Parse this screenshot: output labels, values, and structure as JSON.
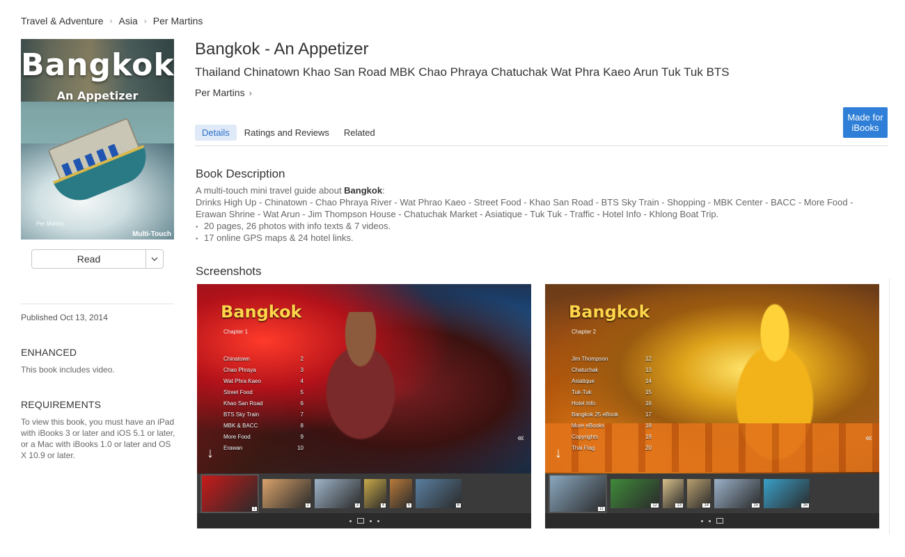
{
  "breadcrumb": [
    "Travel & Adventure",
    "Asia",
    "Per Martins"
  ],
  "cover": {
    "title": "Bangkok",
    "subtitle": "An Appetizer",
    "tag": "Multi-Touch",
    "signature": "Per Martins"
  },
  "read_button": {
    "label": "Read"
  },
  "published": "Published Oct 13, 2014",
  "enhanced": {
    "heading": "ENHANCED",
    "text": "This book includes video."
  },
  "requirements": {
    "heading": "REQUIREMENTS",
    "text": "To view this book, you must have an iPad with iBooks 3 or later and iOS 5.1 or later, or a Mac with iBooks 1.0 or later and OS X 10.9 or later."
  },
  "book": {
    "title": "Bangkok - An Appetizer",
    "subtitle": "Thailand Chinatown Khao San Road MBK Chao Phraya Chatuchak Wat Phra Kaeo Arun Tuk Tuk BTS",
    "author": "Per Martins"
  },
  "badge": {
    "line1": "Made for",
    "line2": "iBooks"
  },
  "tabs": [
    {
      "label": "Details",
      "active": true
    },
    {
      "label": "Ratings and Reviews",
      "active": false
    },
    {
      "label": "Related",
      "active": false
    }
  ],
  "description": {
    "heading": "Book Description",
    "intro_prefix": "A multi-touch mini travel guide about ",
    "intro_bold": "Bangkok",
    "intro_suffix": ":",
    "body": "Drinks High Up - Chinatown - Chao Phraya River - Wat Phrao Kaeo - Street Food - Khao San Road - BTS Sky Train - Shopping - MBK Center - BACC - More Food - Erawan Shrine - Wat Arun - Jim Thompson House - Chatuchak Market - Asiatique - Tuk Tuk - Traffic - Hotel Info - Khlong Boat Trip.",
    "bullets": [
      "20 pages, 26 photos with info texts & 7 videos.",
      "17 online GPS maps & 24 hotel links."
    ]
  },
  "screenshots": {
    "heading": "Screenshots",
    "items": [
      {
        "title": "Bangkok",
        "chapter": "Chapter 1",
        "toc": [
          [
            "Chinatown",
            "2"
          ],
          [
            "Chao Phraya",
            "3"
          ],
          [
            "Wat Phra Kaeo",
            "4"
          ],
          [
            "Street Food",
            "5"
          ],
          [
            "Khao San Road",
            "6"
          ],
          [
            "BTS Sky Train",
            "7"
          ],
          [
            "MBK & BACC",
            "8"
          ],
          [
            "More Food",
            "9"
          ],
          [
            "Erawan",
            "10"
          ]
        ],
        "thumbs": [
          "1",
          "2",
          "3",
          "4",
          "5",
          "6"
        ]
      },
      {
        "title": "Bangkok",
        "chapter": "Chapter 2",
        "toc": [
          [
            "Jim Thompson",
            "12"
          ],
          [
            "Chatuchak",
            "13"
          ],
          [
            "Asiatique",
            "14"
          ],
          [
            "Tuk-Tuk",
            "15"
          ],
          [
            "Hotel Info",
            "16"
          ],
          [
            "Bangkok 25 eBook",
            "17"
          ],
          [
            "More eBooks",
            "18"
          ],
          [
            "Copyrights",
            "19"
          ],
          [
            "Thai Flag",
            "20"
          ]
        ],
        "thumbs": [
          "11",
          "12",
          "13",
          "14",
          "15",
          "16"
        ]
      }
    ]
  },
  "colors": {
    "accent": "#2f7fd8",
    "tab_active_bg": "#dfe9f7",
    "tab_active_text": "#2b6fc8"
  }
}
